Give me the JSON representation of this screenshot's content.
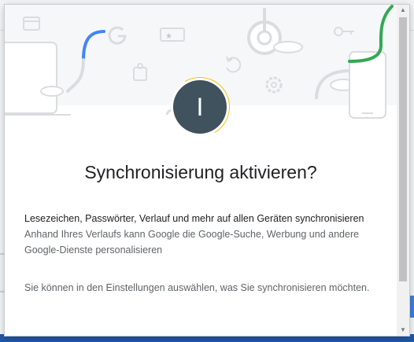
{
  "dialog": {
    "avatar_initial": "I",
    "title": "Synchronisierung aktivieren?",
    "line_primary": "Lesezeichen, Passwörter, Verlauf und mehr auf allen Geräten synchronisieren",
    "line_secondary": "Anhand Ihres Verlaufs kann Google die Google-Suche, Werbung und andere Google-Dienste personalisieren",
    "line_settings": "Sie können in den Einstellungen auswählen, was Sie synchronisieren möchten."
  },
  "illustration_icons": [
    "browser-window-icon",
    "google-g-icon",
    "ticket-icon",
    "chrome-logo-icon",
    "key-icon",
    "puzzle-icon",
    "sync-icon",
    "gear-icon",
    "cloud-icon",
    "laptop-icon",
    "phone-icon"
  ],
  "colors": {
    "google_blue": "#4285f4",
    "google_green": "#34a853",
    "google_yellow": "#f4c20d",
    "avatar_bg": "#3f525e",
    "illustration_gray": "#dadce0"
  },
  "scrollbar": {
    "up_arrow": "▲",
    "down_arrow": "▼"
  }
}
